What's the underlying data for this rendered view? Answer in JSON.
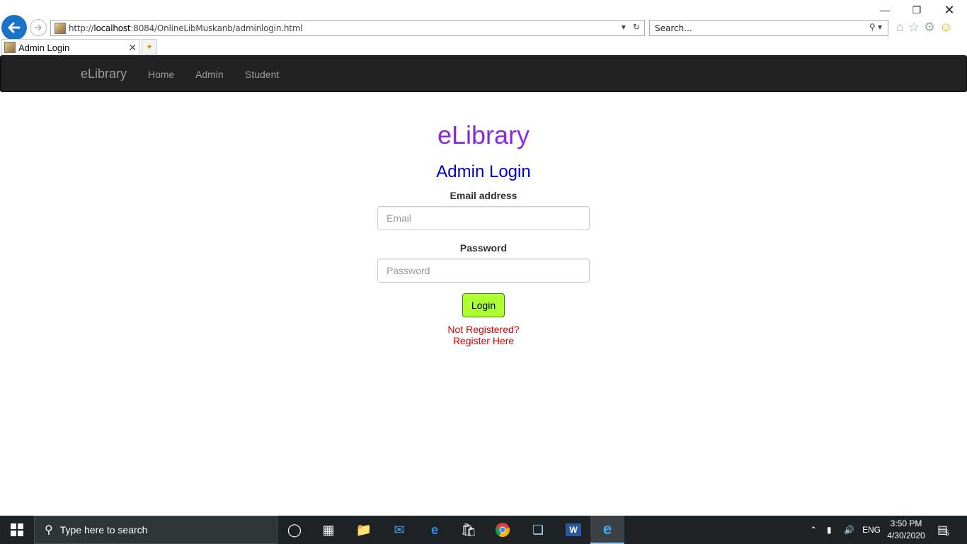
{
  "browser": {
    "url_prefix": "http://",
    "url_host": "localhost",
    "url_rest": ":8084/OnlineLibMuskanb/adminlogin.html",
    "search_placeholder": "Search...",
    "tab_title": "Admin Login"
  },
  "navbar": {
    "brand": "eLibrary",
    "links": [
      "Home",
      "Admin",
      "Student"
    ]
  },
  "login": {
    "site_title": "eLibrary",
    "form_title": "Admin Login",
    "email_label": "Email address",
    "email_placeholder": "Email",
    "password_label": "Password",
    "password_placeholder": "Password",
    "login_button": "Login",
    "not_registered": "Not Registered?",
    "register_link": "Register Here"
  },
  "colors": {
    "site_title": "#8a2be2",
    "form_title": "#0000cd",
    "login_button": "#adff2f",
    "register_text": "#e00000",
    "navbar_bg": "#222222"
  },
  "taskbar": {
    "search_placeholder": "Type here to search",
    "language": "ENG",
    "time": "3:50 PM",
    "date": "4/30/2020",
    "notification_count": "5",
    "icons": [
      "cortana-icon",
      "task-view-icon",
      "file-explorer-icon",
      "mail-icon",
      "edge-icon",
      "store-icon",
      "chrome-icon",
      "virtualbox-icon",
      "word-icon",
      "internet-explorer-icon"
    ]
  }
}
